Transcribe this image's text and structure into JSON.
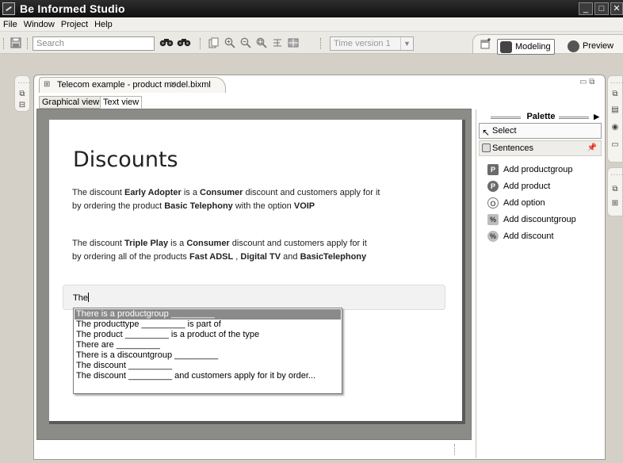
{
  "window": {
    "title": "Be Informed Studio",
    "controls": {
      "minimize": "_",
      "maximize": "□",
      "close": "✕"
    }
  },
  "menubar": {
    "items": [
      "File",
      "Window",
      "Project",
      "Help"
    ]
  },
  "toolbar": {
    "search_placeholder": "Search",
    "time_version": "Time version 1",
    "perspectives": [
      {
        "label": "Modeling",
        "active": true
      },
      {
        "label": "Preview",
        "active": false
      }
    ]
  },
  "editor": {
    "tab_title": "Telecom example - product model.bixml",
    "sub_tabs": [
      {
        "label": "Graphical view",
        "active": false
      },
      {
        "label": "Text view",
        "active": true
      }
    ]
  },
  "document": {
    "heading": "Discounts",
    "para1": {
      "line1": {
        "t1": "The discount ",
        "b1": "Early Adopter",
        "t2": " is a ",
        "b2": "Consumer",
        "t3": " discount  and customers apply for it"
      },
      "line2": {
        "t1": "by ordering the product ",
        "b1": "Basic Telephony",
        "t2": " with the option ",
        "b2": "VOIP"
      }
    },
    "para2": {
      "line1": {
        "t1": "The discount ",
        "b1": "Triple Play",
        "t2": " is a ",
        "b2": "Consumer",
        "t3": " discount  and customers apply for it"
      },
      "line2": {
        "t1": "by ordering all of the products ",
        "b1": "Fast ADSL",
        "t2": " , ",
        "b2": "Digital TV",
        "t3": " and ",
        "b3": "BasicTelephony"
      }
    },
    "input_value": "The",
    "autocomplete": [
      "There is a productgroup _________",
      "The producttype _________ is part of",
      "The product _________ is a product of the type",
      "There are _________",
      "There is a discountgroup _________",
      "The discount _________",
      "The discount _________ and  customers apply for it by order..."
    ]
  },
  "palette": {
    "title": "Palette",
    "select_label": "Select",
    "drawer_label": "Sentences",
    "items": [
      {
        "label": "Add productgroup",
        "icon": "productgroup-icon",
        "glyph": "P"
      },
      {
        "label": "Add product",
        "icon": "product-icon",
        "glyph": "P"
      },
      {
        "label": "Add option",
        "icon": "option-icon",
        "glyph": "O"
      },
      {
        "label": "Add discountgroup",
        "icon": "discountgroup-icon",
        "glyph": "%"
      },
      {
        "label": "Add discount",
        "icon": "discount-icon",
        "glyph": "%"
      }
    ]
  },
  "colors": {
    "titlebar": "#1a1a1a",
    "selection": "#8a8a8a",
    "canvas_frame": "#8b8b88"
  }
}
